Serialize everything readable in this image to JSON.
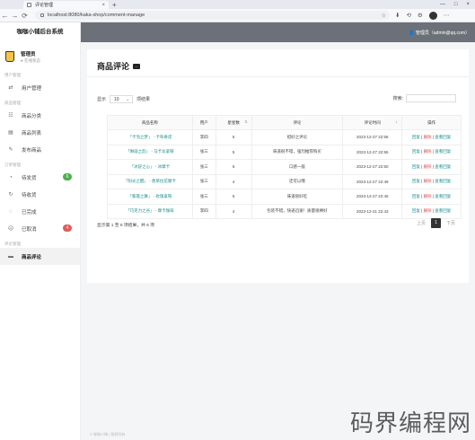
{
  "browser": {
    "tab_title": "评论管理",
    "tab_close": "×",
    "new_tab": "+",
    "url": "localhost:8080/kaka-shop/comment-manage",
    "window_controls": [
      "—",
      "□",
      "×"
    ],
    "nav": [
      "←",
      "→",
      "⟳"
    ],
    "tool_icons": [
      "☆",
      "⬇",
      "⟲",
      "⚙",
      "⋯"
    ]
  },
  "sidebar": {
    "brand": "咖咖小铺后台系统",
    "user_name": "管理员",
    "user_status": "● 在线状态",
    "groups": [
      {
        "label": "用户管理",
        "items": [
          {
            "label": "用户管理",
            "icon": "⇄"
          }
        ]
      },
      {
        "label": "商品管理",
        "items": [
          {
            "label": "商品分类",
            "icon": "☷"
          },
          {
            "label": "商品列表",
            "icon": "▤"
          },
          {
            "label": "发布商品",
            "icon": "✎"
          }
        ]
      },
      {
        "label": "订单管理",
        "items": [
          {
            "label": "待发货",
            "icon": "◔",
            "badge": "6",
            "badge_color": "#4caf50"
          },
          {
            "label": "待收货",
            "icon": "↻"
          },
          {
            "label": "已完成",
            "icon": "◌"
          },
          {
            "label": "已取消",
            "icon": "☹",
            "badge": "4",
            "badge_color": "#e05c5c"
          }
        ]
      },
      {
        "label": "评论管理",
        "items": [
          {
            "label": "商品评论",
            "icon": "▬",
            "active": true
          }
        ]
      }
    ]
  },
  "topbar": {
    "user": "👤 管理员（admin@qq.com）"
  },
  "main": {
    "title": "商品评论",
    "show_prefix": "显示",
    "page_size": "10",
    "show_suffix": "项结果",
    "search_label": "搜索:",
    "columns": [
      "商品名称",
      "用户",
      "星星数",
      "评论",
      "评论时间",
      "操作"
    ],
    "rows": [
      {
        "name": "「卡泡之梦」 - 卡布奇诺",
        "user": "李四",
        "stars": "5",
        "comment": "挺好之评论",
        "time": "2023-12-27 22:56"
      },
      {
        "name": "「琳珑之韵」 - 马卡龙拿铁",
        "user": "张三",
        "stars": "5",
        "comment": "味道很不错，强烈推荐购买",
        "time": "2023-12-27 22:55"
      },
      {
        "name": "「冰舒之心」 - 冰摩卡",
        "user": "张三",
        "stars": "5",
        "comment": "口感一般",
        "time": "2023-12-27 22:50"
      },
      {
        "name": "「阳光之醒」 - 香草拉花摩卡",
        "user": "张三",
        "stars": "4",
        "comment": "还可以哦",
        "time": "2023-12-27 22:49"
      },
      {
        "name": "「紫霞之舞」 - 玫瑰拿铁",
        "user": "张三",
        "stars": "5",
        "comment": "味道很好吃",
        "time": "2023-12-27 22:46"
      },
      {
        "name": "「巧克力之谷」 - 摩卡咖啡",
        "user": "李四",
        "stars": "4",
        "comment": "包装不错，快递迅速！质量很棒好",
        "time": "2023-12-21 22:43"
      }
    ],
    "op_edit": "回复",
    "op_sep": "|",
    "op_del": "删除",
    "op_view": "查看回复",
    "footer_info": "显示第 1 至 6 项结果，共 6 项",
    "pager": {
      "prev": "上页",
      "current": "1",
      "next": "下页"
    }
  },
  "footer": "© 咖咖小铺  |  版权所有",
  "watermark": "码界编程网"
}
